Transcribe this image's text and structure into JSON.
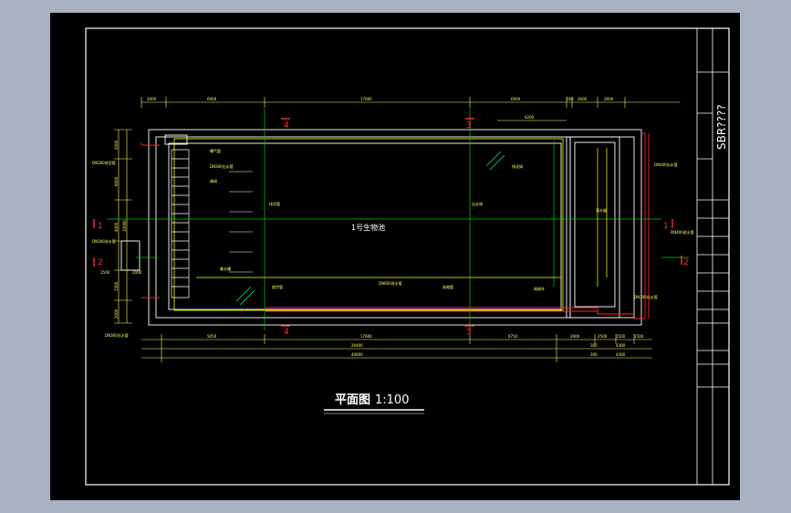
{
  "drawing": {
    "title": "平面图",
    "scale": "1:100",
    "tank_name": "1号生物池",
    "title_block_code": "SBR????"
  },
  "dims_top": [
    "2000",
    "6000",
    "17600",
    "6000",
    "300",
    "2600",
    "2600"
  ],
  "dims_top_sub": [
    "6200"
  ],
  "dims_bottom_row1": [
    "5050",
    "17600",
    "6750",
    "2000",
    "2500",
    "1500",
    "1500"
  ],
  "dims_bottom_row2": [
    "29400",
    "300",
    "4300"
  ],
  "dims_bottom_row3": [
    "40800",
    "300",
    "4300"
  ],
  "dims_left": [
    "2000",
    "6000",
    "10000",
    "4000",
    "1500",
    "2000",
    "1500",
    "2000"
  ],
  "section_marks": {
    "left": "1",
    "left2": "2",
    "right": "1",
    "right2": "2",
    "top_a": "4",
    "top_b": "3",
    "bottom_a": "4",
    "bottom_b": "3"
  },
  "pipe_labels": [
    "DN300排泥管",
    "DN300进水管",
    "DN300出水管",
    "DN400出水管",
    "DN400进水管",
    "DN300出水管",
    "DN600进水管",
    "DN300出水管"
  ],
  "small_labels": [
    "曝气管",
    "闸阀",
    "排泥管",
    "出水堰",
    "集水槽",
    "放空管",
    "渐缩管",
    "闸阀井",
    "排泥阀",
    "滗水器"
  ]
}
